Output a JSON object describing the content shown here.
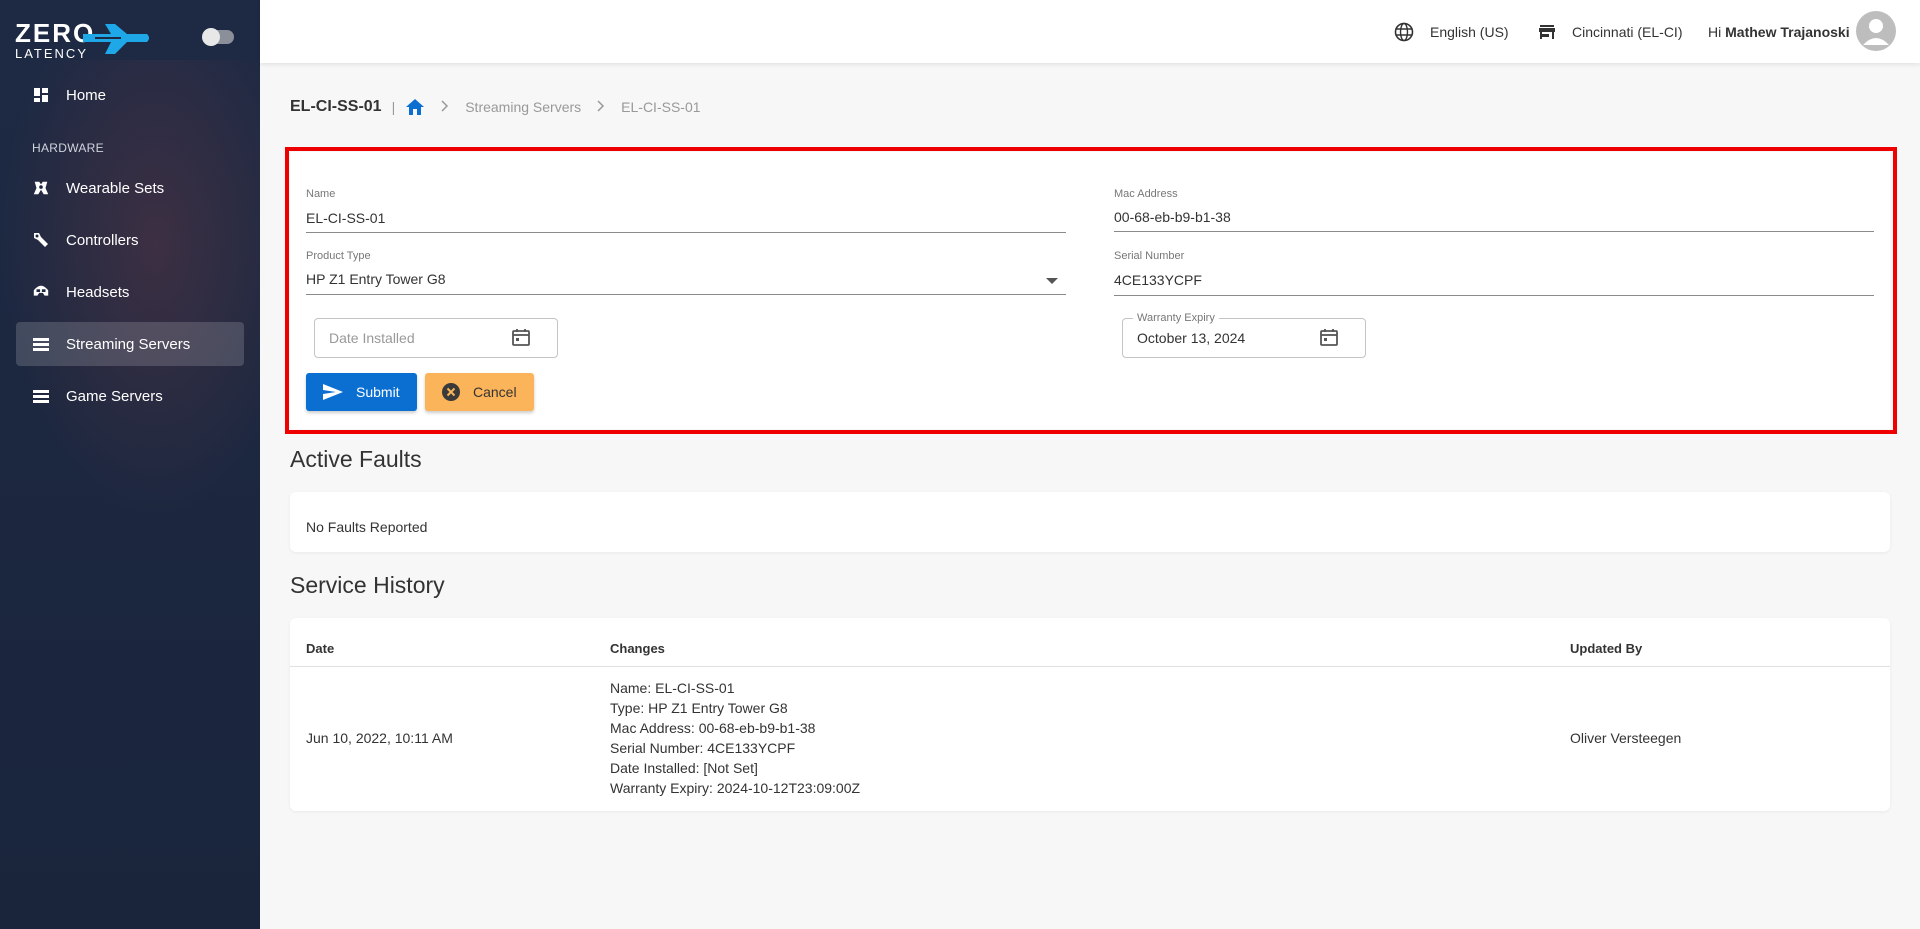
{
  "logo": {
    "line1": "ZERO",
    "line2": "LATENCY"
  },
  "sidebar": {
    "home": "Home",
    "section": "HARDWARE",
    "items": [
      {
        "label": "Wearable Sets"
      },
      {
        "label": "Controllers"
      },
      {
        "label": "Headsets"
      },
      {
        "label": "Streaming Servers"
      },
      {
        "label": "Game Servers"
      }
    ]
  },
  "topbar": {
    "language": "English (US)",
    "location": "Cincinnati (EL-CI)",
    "greeting": "Hi",
    "user": "Mathew Trajanoski"
  },
  "breadcrumb": {
    "title": "EL-CI-SS-01",
    "separator": "|",
    "crumbs": [
      "Streaming Servers",
      "EL-CI-SS-01"
    ]
  },
  "form": {
    "name_label": "Name",
    "name_value": "EL-CI-SS-01",
    "mac_label": "Mac Address",
    "mac_value": "00-68-eb-b9-b1-38",
    "type_label": "Product Type",
    "type_value": "HP Z1 Entry Tower G8",
    "serial_label": "Serial Number",
    "serial_value": "4CE133YCPF",
    "date_installed_placeholder": "Date Installed",
    "warranty_label": "Warranty Expiry",
    "warranty_value": "October 13, 2024",
    "submit_label": "Submit",
    "cancel_label": "Cancel"
  },
  "faults": {
    "title": "Active Faults",
    "empty": "No Faults Reported"
  },
  "history": {
    "title": "Service History",
    "columns": [
      "Date",
      "Changes",
      "Updated By"
    ],
    "rows": [
      {
        "date": "Jun 10, 2022, 10:11 AM",
        "changes": [
          "Name: EL-CI-SS-01",
          "Type: HP Z1 Entry Tower G8",
          "Mac Address: 00-68-eb-b9-b1-38",
          "Serial Number: 4CE133YCPF",
          "Date Installed: [Not Set]",
          "Warranty Expiry: 2024-10-12T23:09:00Z"
        ],
        "updated_by": "Oliver Versteegen"
      }
    ]
  },
  "colors": {
    "sidebar_bg": "#1e2a44",
    "primary": "#0a6fd1",
    "cancel": "#fbb45a",
    "highlight": "#ee0000",
    "logo_accent": "#1fa8e8"
  }
}
